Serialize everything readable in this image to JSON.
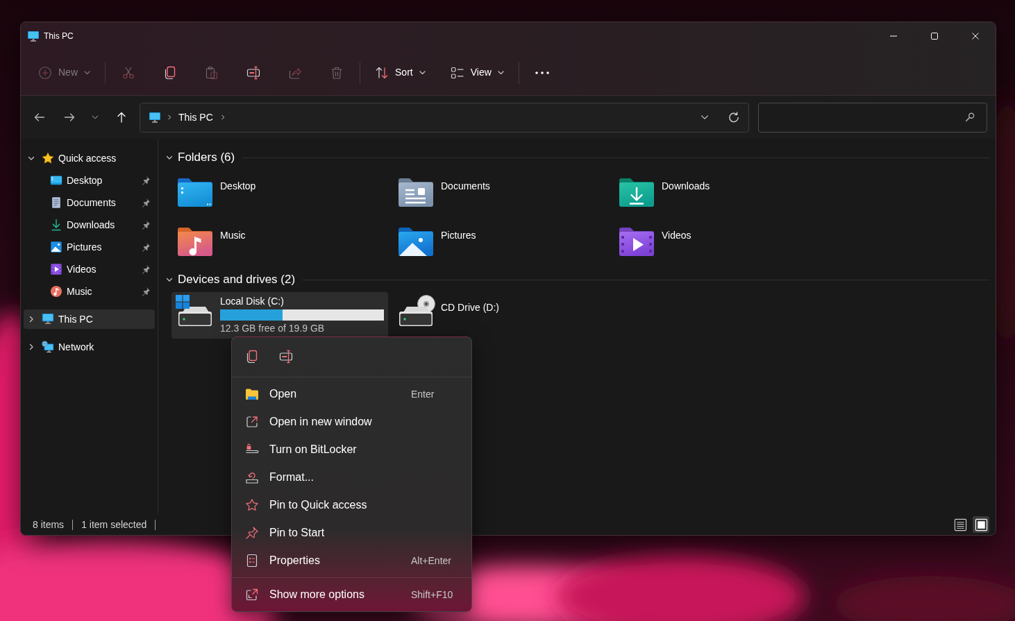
{
  "window": {
    "title": "This PC"
  },
  "toolbar": {
    "groups": [
      [
        {
          "label": "New",
          "dropdown": true,
          "disabled": true
        }
      ],
      [
        {
          "disabled": true
        },
        {
          "disabled": false
        },
        {
          "disabled": true
        },
        {
          "disabled": false
        },
        {
          "disabled": true
        },
        {
          "disabled": true
        }
      ],
      [
        {
          "label": "Sort",
          "dropdown": true,
          "disabled": false
        },
        {
          "label": "View",
          "dropdown": true,
          "disabled": false
        }
      ],
      [
        {
          "disabled": false
        }
      ]
    ]
  },
  "address_bar": {
    "breadcrumbs": [
      "This PC"
    ]
  },
  "sidebar": {
    "items": [
      {
        "label": "Quick access",
        "expanded": true,
        "selected": false,
        "children": [
          {
            "label": "Desktop",
            "pinned": true,
            "selected": false
          },
          {
            "label": "Documents",
            "pinned": true,
            "selected": false
          },
          {
            "label": "Downloads",
            "pinned": true,
            "selected": false
          },
          {
            "label": "Pictures",
            "pinned": true,
            "selected": false
          },
          {
            "label": "Videos",
            "pinned": true,
            "selected": false
          },
          {
            "label": "Music",
            "pinned": true,
            "selected": false
          }
        ]
      },
      {
        "label": "This PC",
        "expanded": false,
        "selected": true
      },
      {
        "label": "Network",
        "expanded": false,
        "selected": false
      }
    ]
  },
  "sections": [
    {
      "title": "Folders (6)",
      "expanded": true,
      "folders": [
        {
          "name": "Desktop",
          "selected": false
        },
        {
          "name": "Documents",
          "selected": false
        },
        {
          "name": "Downloads",
          "selected": false
        },
        {
          "name": "Music",
          "selected": false
        },
        {
          "name": "Pictures",
          "selected": false
        },
        {
          "name": "Videos",
          "selected": false
        }
      ]
    },
    {
      "title": "Devices and drives (2)",
      "expanded": true,
      "drives": [
        {
          "kind": "disk",
          "name": "Local Disk (C:)",
          "level": 0.38,
          "free_space": "12.3 GB free of 19.9 GB",
          "selected": true
        },
        {
          "kind": "optical",
          "name": "CD Drive (D:)",
          "selected": false
        }
      ]
    }
  ],
  "context_menu": {
    "groups": [
      [
        {
          "label": "Open",
          "shortcut": "Enter"
        },
        {
          "label": "Open in new window"
        },
        {
          "label": "Turn on BitLocker"
        },
        {
          "label": "Format..."
        },
        {
          "label": "Pin to Quick access"
        },
        {
          "label": "Pin to Start"
        },
        {
          "label": "Properties",
          "shortcut": "Alt+Enter"
        }
      ],
      [
        {
          "label": "Show more options",
          "shortcut": "Shift+F10"
        }
      ]
    ]
  },
  "status_bar": {
    "item_count": "8 items",
    "selection": "1 item selected",
    "views": [
      {
        "selected": false
      },
      {
        "selected": true
      }
    ]
  }
}
